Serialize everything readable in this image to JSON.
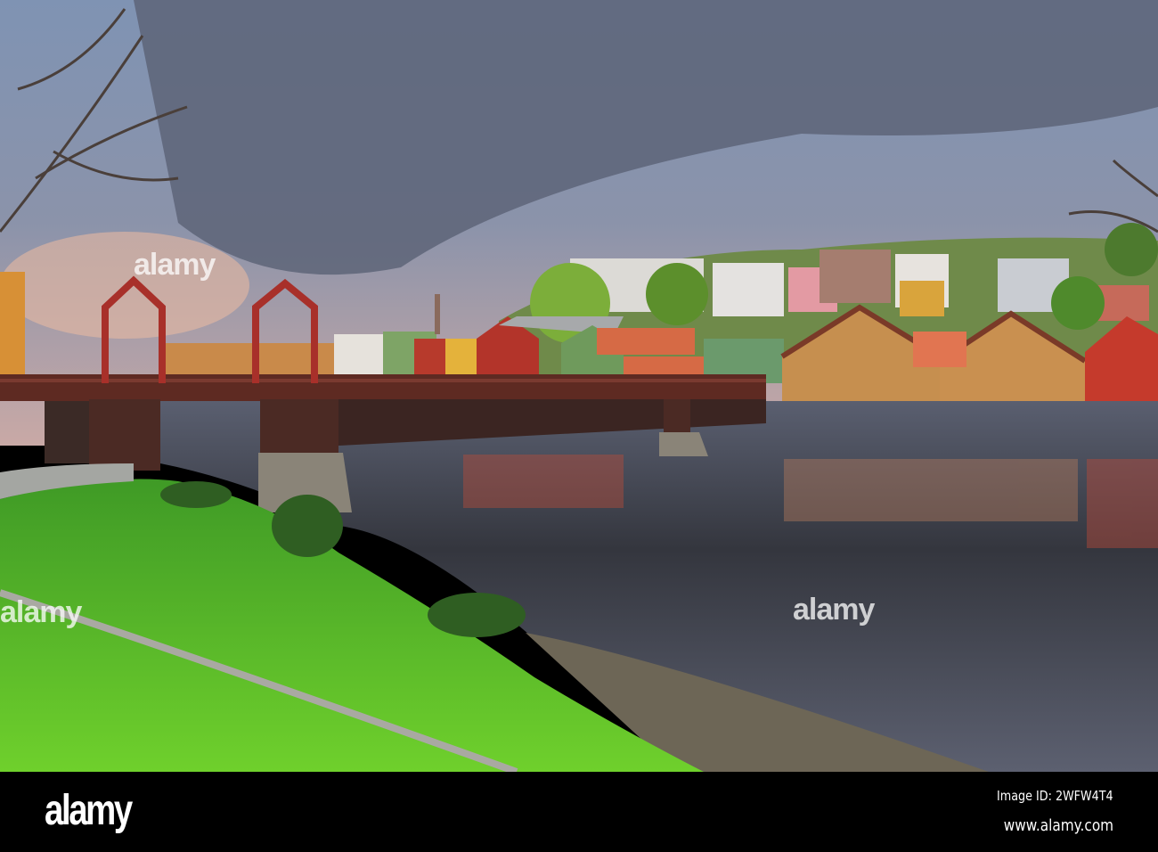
{
  "photo": {
    "subject": "Old Town Bridge over the Nidelva river with colorful wharf houses"
  },
  "watermark": {
    "text": "alamy"
  },
  "footer": {
    "logo": "alamy",
    "image_id": "Image ID: 2WFW4T4",
    "url": "www.alamy.com"
  },
  "colors": {
    "sky_top": "#8fa6c4",
    "cloud": "#5c6478",
    "grass": "#5bbd2a",
    "water": "#3a3d45",
    "bridge": "#5e2a22"
  }
}
